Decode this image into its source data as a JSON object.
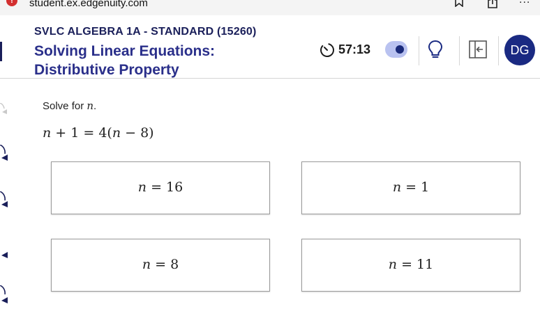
{
  "browser": {
    "url": "student.ex.edgenuity.com",
    "warning_glyph": "!",
    "more_label": "..."
  },
  "header": {
    "course": "SVLC ALGEBRA 1A - STANDARD (15260)",
    "title_line1": "Solving Linear Equations:",
    "title_line2": "Distributive Property",
    "timer": "57:13",
    "avatar_initials": "DG"
  },
  "question": {
    "prompt": "Solve for",
    "variable": "n",
    "prompt_end": ".",
    "equation": "n + 1 = 4(n − 8)"
  },
  "choices": [
    {
      "label": "n = 16"
    },
    {
      "label": "n = 1"
    },
    {
      "label": "n = 8"
    },
    {
      "label": "n = 11"
    }
  ],
  "colors": {
    "title": "#2a2f8a",
    "avatar": "#1a2a82",
    "toggle_track": "#b9c2f0",
    "toggle_knob": "#1a2a7a",
    "warning": "#d32f2f"
  }
}
